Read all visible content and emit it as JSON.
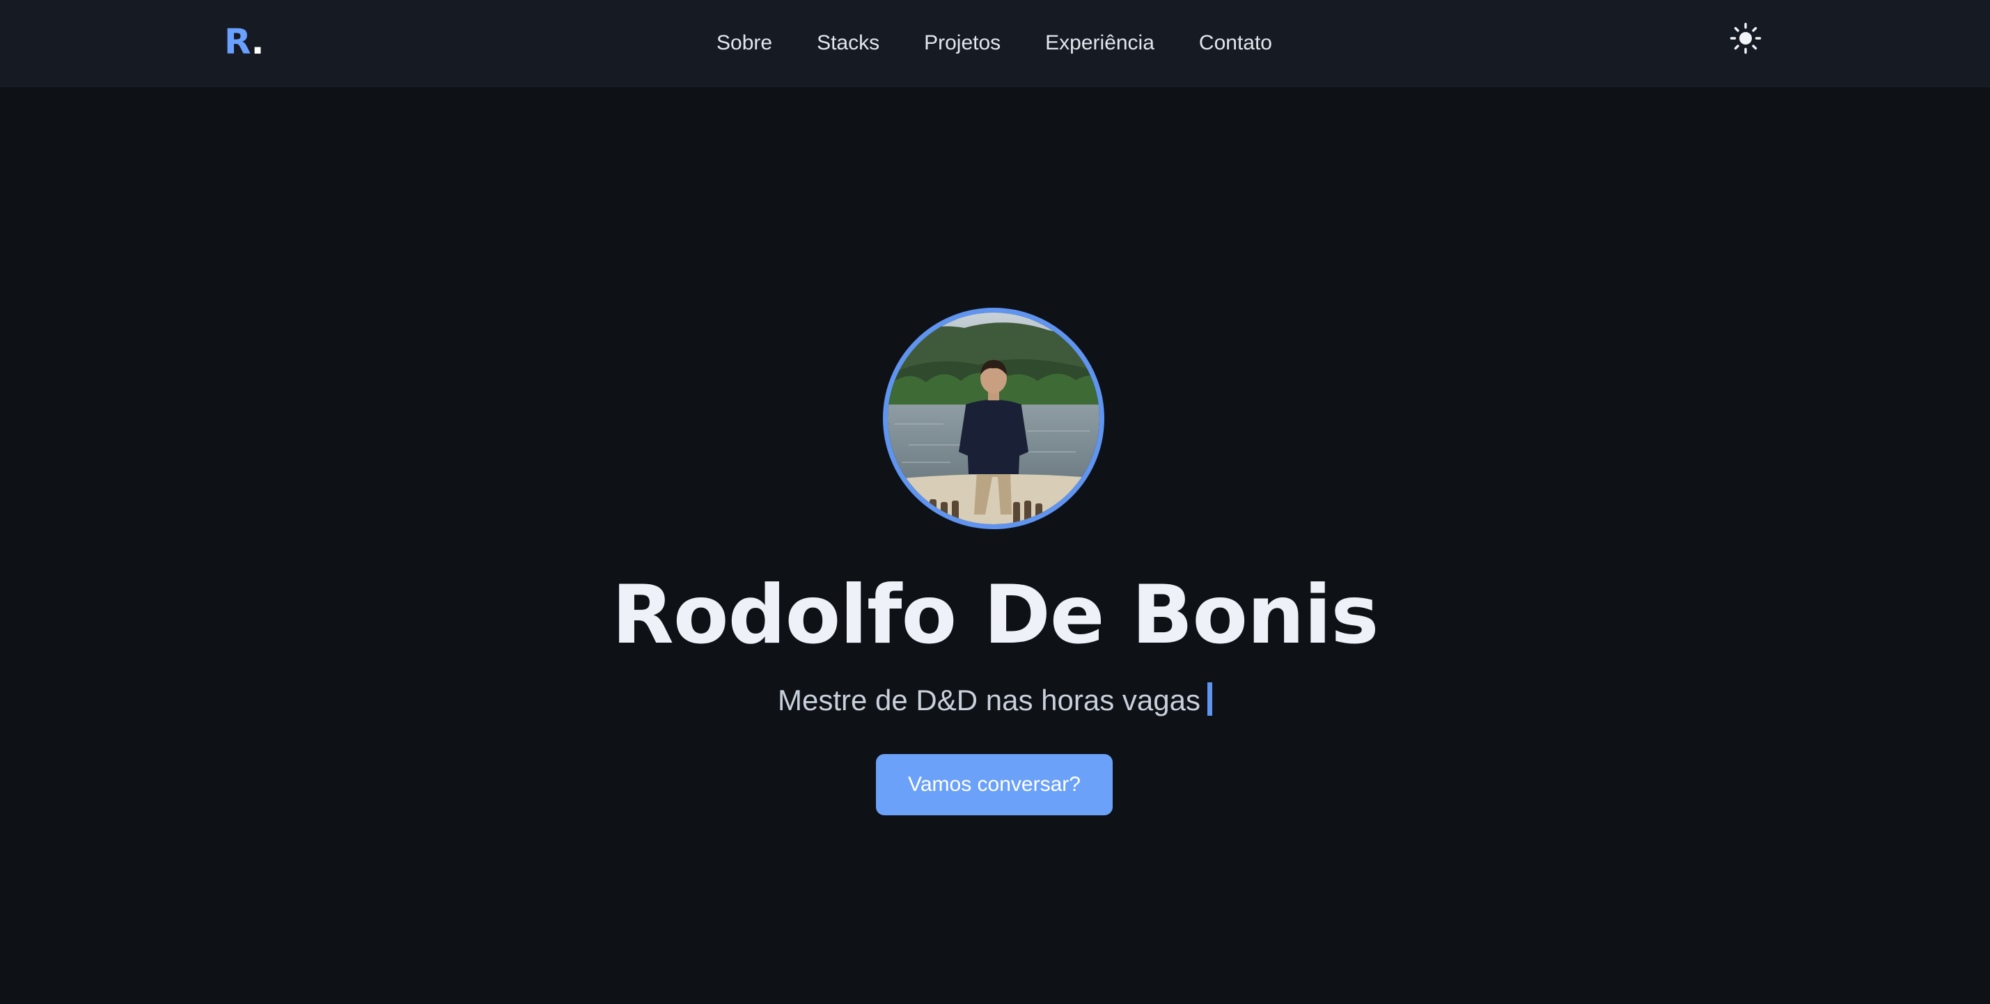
{
  "header": {
    "logo_letter": "R",
    "logo_dot": ".",
    "nav": [
      {
        "label": "Sobre"
      },
      {
        "label": "Stacks"
      },
      {
        "label": "Projetos"
      },
      {
        "label": "Experiência"
      },
      {
        "label": "Contato"
      }
    ],
    "theme_toggle_icon": "sun-icon"
  },
  "hero": {
    "name": "Rodolfo De Bonis",
    "subtitle": "Mestre de D&D nas horas vagas",
    "cta_label": "Vamos conversar?",
    "avatar_icon": "profile-photo"
  },
  "colors": {
    "background": "#0e1116",
    "navbar": "#161a22",
    "accent": "#6ba1f9",
    "avatar_border": "#5f95f0",
    "heading": "#eef2f8",
    "subtitle": "#c9d0da"
  }
}
